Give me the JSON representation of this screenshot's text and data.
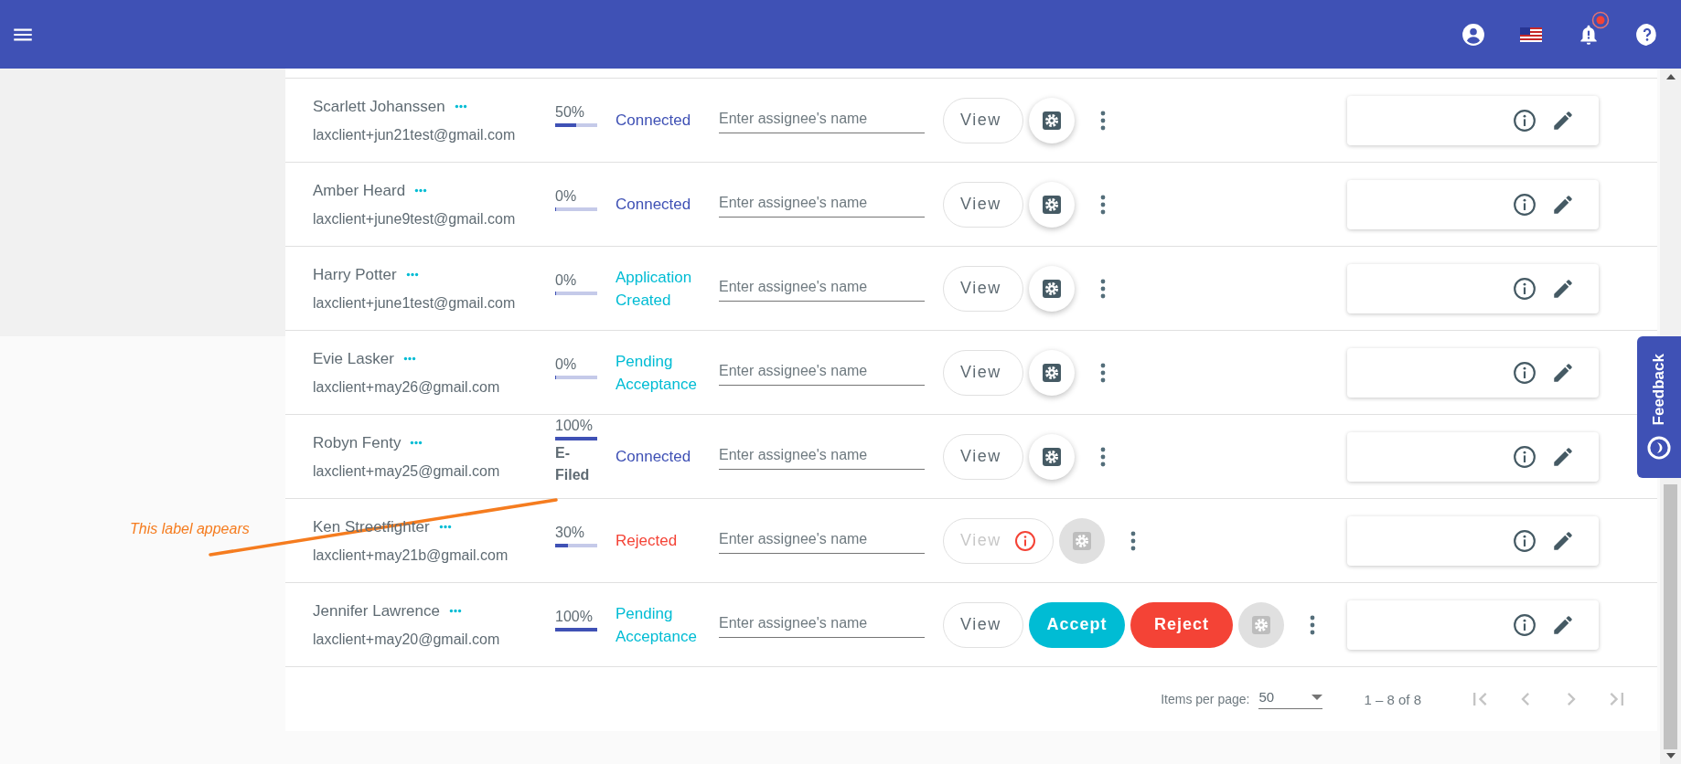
{
  "annotation": {
    "text": "This label appears"
  },
  "rows": [
    {
      "name": "Scarlett Johanssen",
      "email": "laxclient+jun21test@gmail.com",
      "progress": "50%",
      "level": 0.5,
      "status": "Connected",
      "color": "#3f51b5",
      "placeholder": "Enter assignee's name",
      "view": "View",
      "view_disabled": false,
      "settings_disabled": false
    },
    {
      "name": "Amber Heard",
      "email": "laxclient+june9test@gmail.com",
      "progress": "0%",
      "level": 0,
      "status": "Connected",
      "color": "#3f51b5",
      "placeholder": "Enter assignee's name",
      "view": "View",
      "view_disabled": false,
      "settings_disabled": false
    },
    {
      "name": "Harry Potter",
      "email": "laxclient+june1test@gmail.com",
      "progress": "0%",
      "level": 0,
      "status": "Application Created",
      "color": "#00bcd4",
      "placeholder": "Enter assignee's name",
      "view": "View",
      "view_disabled": false,
      "settings_disabled": false
    },
    {
      "name": "Evie Lasker",
      "email": "laxclient+may26@gmail.com",
      "progress": "0%",
      "level": 0,
      "status": "Pending Acceptance",
      "color": "#00bcd4",
      "placeholder": "Enter assignee's name",
      "view": "View",
      "view_disabled": false,
      "settings_disabled": false
    },
    {
      "name": "Robyn Fenty",
      "email": "laxclient+may25@gmail.com",
      "progress": "100%",
      "level": 1,
      "badge": "E-Filed",
      "status": "Connected",
      "color": "#3f51b5",
      "placeholder": "Enter assignee's name",
      "view": "View",
      "view_disabled": false,
      "settings_disabled": false
    },
    {
      "name": "Ken Streetfighter",
      "email": "laxclient+may21b@gmail.com",
      "progress": "30%",
      "level": 0.3,
      "status": "Rejected",
      "color": "#f44336",
      "placeholder": "Enter assignee's name",
      "view": "View",
      "view_disabled": true,
      "warning": true,
      "settings_disabled": true
    },
    {
      "name": "Jennifer Lawrence",
      "email": "laxclient+may20@gmail.com",
      "progress": "100%",
      "level": 1,
      "status": "Pending Acceptance",
      "color": "#00bcd4",
      "placeholder": "Enter assignee's name",
      "view": "View",
      "view_disabled": false,
      "settings_disabled": true,
      "accept": "Accept",
      "reject": "Reject"
    }
  ],
  "paginator": {
    "label": "Items per page:",
    "page_size": "50",
    "range": "1 – 8 of 8"
  },
  "feedback": {
    "label": "Feedback"
  }
}
